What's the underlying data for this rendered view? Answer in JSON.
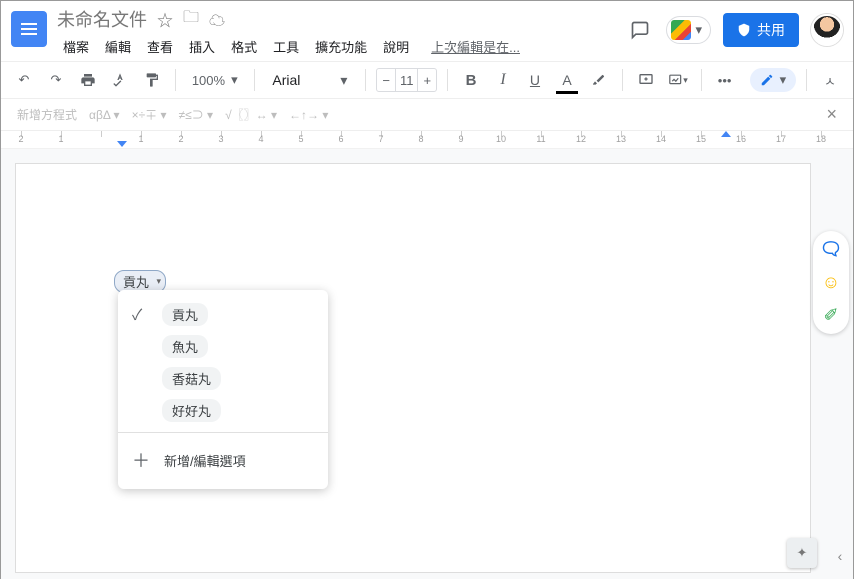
{
  "header": {
    "doc_title": "未命名文件",
    "menus": [
      "檔案",
      "編輯",
      "查看",
      "插入",
      "格式",
      "工具",
      "擴充功能",
      "說明"
    ],
    "last_edit": "上次編輯是在...",
    "share_label": "共用"
  },
  "toolbar": {
    "zoom": "100%",
    "font_name": "Arial",
    "font_size": "11",
    "bold": "B",
    "italic": "I",
    "underline": "U",
    "text_color": "A",
    "more": "•••"
  },
  "eqbar": {
    "new_eq": "新增方程式",
    "groups": [
      "αβΔ ▾",
      "×÷∓ ▾",
      "≠≤⊃ ▾",
      "√〖〗↔ ▾",
      "←↑→ ▾"
    ]
  },
  "ruler": {
    "start": 2,
    "values": [
      2,
      1,
      "",
      1,
      2,
      3,
      4,
      5,
      6,
      7,
      8,
      9,
      10,
      11,
      12,
      13,
      14,
      15,
      16,
      17,
      18
    ]
  },
  "chip": {
    "selected": "貢丸"
  },
  "dropdown": {
    "options": [
      {
        "label": "貢丸",
        "checked": true
      },
      {
        "label": "魚丸",
        "checked": false
      },
      {
        "label": "香菇丸",
        "checked": false
      },
      {
        "label": "好好丸",
        "checked": false
      }
    ],
    "add_edit": "新增/編輯選項"
  }
}
